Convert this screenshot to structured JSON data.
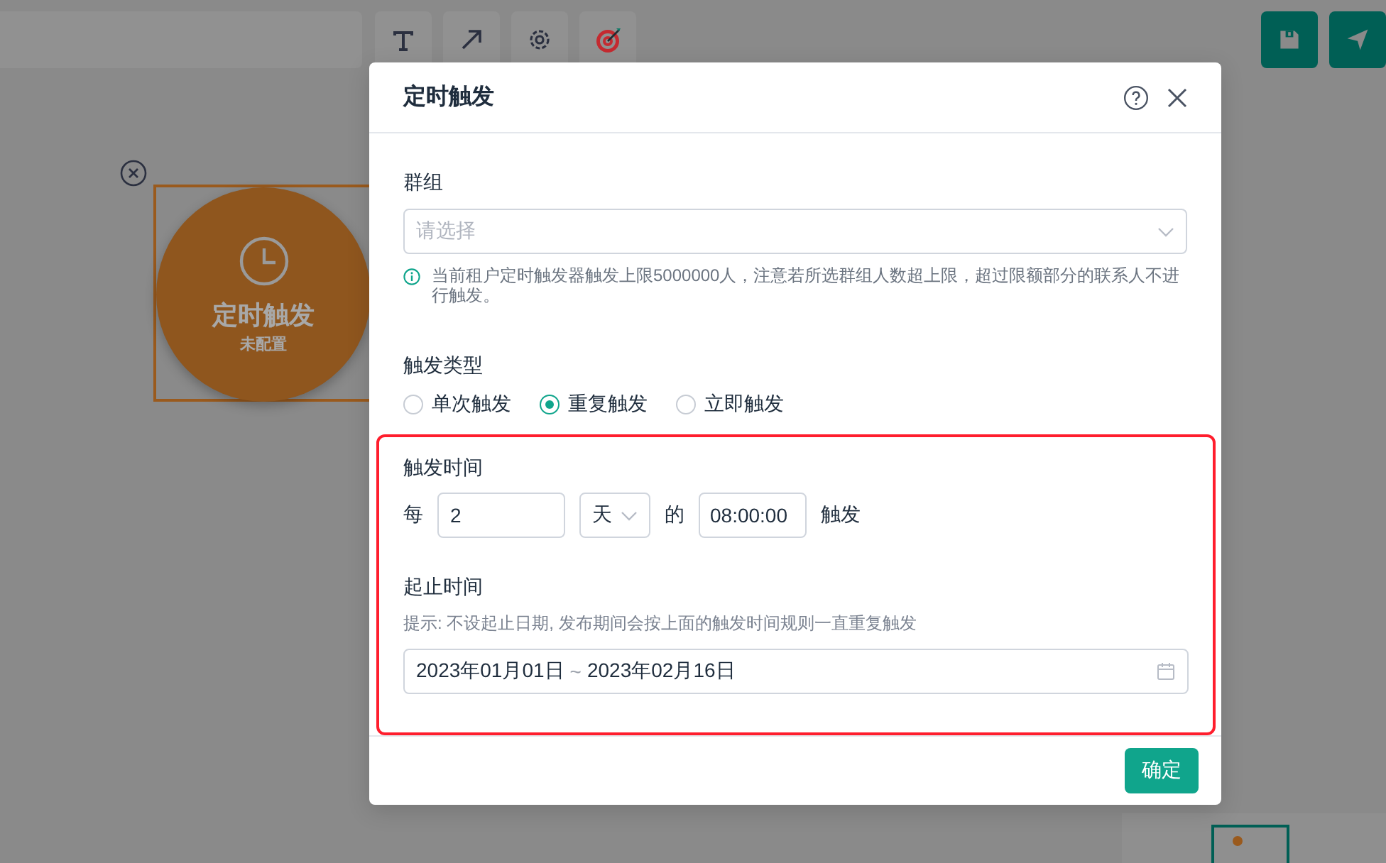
{
  "toolbar": {
    "tools": [
      {
        "kind": "text"
      },
      {
        "kind": "arrow"
      },
      {
        "kind": "settings"
      },
      {
        "kind": "target"
      }
    ]
  },
  "actions": [
    {
      "kind": "save"
    },
    {
      "kind": "send"
    }
  ],
  "canvas": {
    "node": {
      "title": "定时触发",
      "subtitle": "未配置"
    }
  },
  "dialog": {
    "title": "定时触发",
    "group": {
      "label": "群组",
      "placeholder": "请选择",
      "hint": "当前租户定时触发器触发上限5000000人，注意若所选群组人数超上限，超过限额部分的联系人不进行触发。"
    },
    "trigger_type": {
      "label": "触发类型",
      "options": [
        {
          "label": "单次触发",
          "selected": false
        },
        {
          "label": "重复触发",
          "selected": true
        },
        {
          "label": "立即触发",
          "selected": false
        }
      ]
    },
    "trigger_time": {
      "label": "触发时间",
      "prefix": "每",
      "interval": "2",
      "unit": "天",
      "connector": "的",
      "time": "08:00:00",
      "suffix": "触发"
    },
    "date_range": {
      "label": "起止时间",
      "tip": "提示: 不设起止日期, 发布期间会按上面的触发时间规则一直重复触发",
      "start": "2023年01月01日",
      "separator": "~",
      "end": "2023年02月16日"
    },
    "confirm": "确定"
  }
}
